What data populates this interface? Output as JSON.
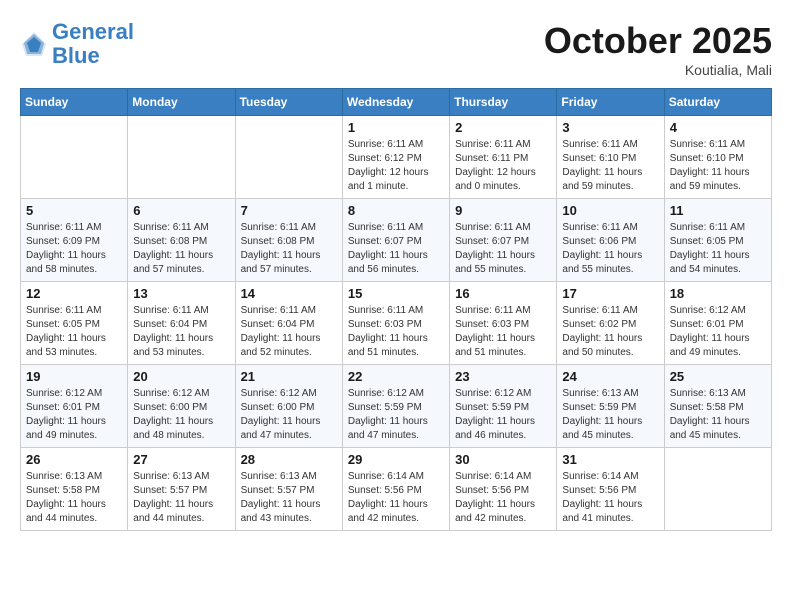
{
  "header": {
    "logo_line1": "General",
    "logo_line2": "Blue",
    "month_year": "October 2025",
    "location": "Koutialia, Mali"
  },
  "weekdays": [
    "Sunday",
    "Monday",
    "Tuesday",
    "Wednesday",
    "Thursday",
    "Friday",
    "Saturday"
  ],
  "weeks": [
    [
      {
        "day": "",
        "sunrise": "",
        "sunset": "",
        "daylight": ""
      },
      {
        "day": "",
        "sunrise": "",
        "sunset": "",
        "daylight": ""
      },
      {
        "day": "",
        "sunrise": "",
        "sunset": "",
        "daylight": ""
      },
      {
        "day": "1",
        "sunrise": "Sunrise: 6:11 AM",
        "sunset": "Sunset: 6:12 PM",
        "daylight": "Daylight: 12 hours and 1 minute."
      },
      {
        "day": "2",
        "sunrise": "Sunrise: 6:11 AM",
        "sunset": "Sunset: 6:11 PM",
        "daylight": "Daylight: 12 hours and 0 minutes."
      },
      {
        "day": "3",
        "sunrise": "Sunrise: 6:11 AM",
        "sunset": "Sunset: 6:10 PM",
        "daylight": "Daylight: 11 hours and 59 minutes."
      },
      {
        "day": "4",
        "sunrise": "Sunrise: 6:11 AM",
        "sunset": "Sunset: 6:10 PM",
        "daylight": "Daylight: 11 hours and 59 minutes."
      }
    ],
    [
      {
        "day": "5",
        "sunrise": "Sunrise: 6:11 AM",
        "sunset": "Sunset: 6:09 PM",
        "daylight": "Daylight: 11 hours and 58 minutes."
      },
      {
        "day": "6",
        "sunrise": "Sunrise: 6:11 AM",
        "sunset": "Sunset: 6:08 PM",
        "daylight": "Daylight: 11 hours and 57 minutes."
      },
      {
        "day": "7",
        "sunrise": "Sunrise: 6:11 AM",
        "sunset": "Sunset: 6:08 PM",
        "daylight": "Daylight: 11 hours and 57 minutes."
      },
      {
        "day": "8",
        "sunrise": "Sunrise: 6:11 AM",
        "sunset": "Sunset: 6:07 PM",
        "daylight": "Daylight: 11 hours and 56 minutes."
      },
      {
        "day": "9",
        "sunrise": "Sunrise: 6:11 AM",
        "sunset": "Sunset: 6:07 PM",
        "daylight": "Daylight: 11 hours and 55 minutes."
      },
      {
        "day": "10",
        "sunrise": "Sunrise: 6:11 AM",
        "sunset": "Sunset: 6:06 PM",
        "daylight": "Daylight: 11 hours and 55 minutes."
      },
      {
        "day": "11",
        "sunrise": "Sunrise: 6:11 AM",
        "sunset": "Sunset: 6:05 PM",
        "daylight": "Daylight: 11 hours and 54 minutes."
      }
    ],
    [
      {
        "day": "12",
        "sunrise": "Sunrise: 6:11 AM",
        "sunset": "Sunset: 6:05 PM",
        "daylight": "Daylight: 11 hours and 53 minutes."
      },
      {
        "day": "13",
        "sunrise": "Sunrise: 6:11 AM",
        "sunset": "Sunset: 6:04 PM",
        "daylight": "Daylight: 11 hours and 53 minutes."
      },
      {
        "day": "14",
        "sunrise": "Sunrise: 6:11 AM",
        "sunset": "Sunset: 6:04 PM",
        "daylight": "Daylight: 11 hours and 52 minutes."
      },
      {
        "day": "15",
        "sunrise": "Sunrise: 6:11 AM",
        "sunset": "Sunset: 6:03 PM",
        "daylight": "Daylight: 11 hours and 51 minutes."
      },
      {
        "day": "16",
        "sunrise": "Sunrise: 6:11 AM",
        "sunset": "Sunset: 6:03 PM",
        "daylight": "Daylight: 11 hours and 51 minutes."
      },
      {
        "day": "17",
        "sunrise": "Sunrise: 6:11 AM",
        "sunset": "Sunset: 6:02 PM",
        "daylight": "Daylight: 11 hours and 50 minutes."
      },
      {
        "day": "18",
        "sunrise": "Sunrise: 6:12 AM",
        "sunset": "Sunset: 6:01 PM",
        "daylight": "Daylight: 11 hours and 49 minutes."
      }
    ],
    [
      {
        "day": "19",
        "sunrise": "Sunrise: 6:12 AM",
        "sunset": "Sunset: 6:01 PM",
        "daylight": "Daylight: 11 hours and 49 minutes."
      },
      {
        "day": "20",
        "sunrise": "Sunrise: 6:12 AM",
        "sunset": "Sunset: 6:00 PM",
        "daylight": "Daylight: 11 hours and 48 minutes."
      },
      {
        "day": "21",
        "sunrise": "Sunrise: 6:12 AM",
        "sunset": "Sunset: 6:00 PM",
        "daylight": "Daylight: 11 hours and 47 minutes."
      },
      {
        "day": "22",
        "sunrise": "Sunrise: 6:12 AM",
        "sunset": "Sunset: 5:59 PM",
        "daylight": "Daylight: 11 hours and 47 minutes."
      },
      {
        "day": "23",
        "sunrise": "Sunrise: 6:12 AM",
        "sunset": "Sunset: 5:59 PM",
        "daylight": "Daylight: 11 hours and 46 minutes."
      },
      {
        "day": "24",
        "sunrise": "Sunrise: 6:13 AM",
        "sunset": "Sunset: 5:59 PM",
        "daylight": "Daylight: 11 hours and 45 minutes."
      },
      {
        "day": "25",
        "sunrise": "Sunrise: 6:13 AM",
        "sunset": "Sunset: 5:58 PM",
        "daylight": "Daylight: 11 hours and 45 minutes."
      }
    ],
    [
      {
        "day": "26",
        "sunrise": "Sunrise: 6:13 AM",
        "sunset": "Sunset: 5:58 PM",
        "daylight": "Daylight: 11 hours and 44 minutes."
      },
      {
        "day": "27",
        "sunrise": "Sunrise: 6:13 AM",
        "sunset": "Sunset: 5:57 PM",
        "daylight": "Daylight: 11 hours and 44 minutes."
      },
      {
        "day": "28",
        "sunrise": "Sunrise: 6:13 AM",
        "sunset": "Sunset: 5:57 PM",
        "daylight": "Daylight: 11 hours and 43 minutes."
      },
      {
        "day": "29",
        "sunrise": "Sunrise: 6:14 AM",
        "sunset": "Sunset: 5:56 PM",
        "daylight": "Daylight: 11 hours and 42 minutes."
      },
      {
        "day": "30",
        "sunrise": "Sunrise: 6:14 AM",
        "sunset": "Sunset: 5:56 PM",
        "daylight": "Daylight: 11 hours and 42 minutes."
      },
      {
        "day": "31",
        "sunrise": "Sunrise: 6:14 AM",
        "sunset": "Sunset: 5:56 PM",
        "daylight": "Daylight: 11 hours and 41 minutes."
      },
      {
        "day": "",
        "sunrise": "",
        "sunset": "",
        "daylight": ""
      }
    ]
  ]
}
